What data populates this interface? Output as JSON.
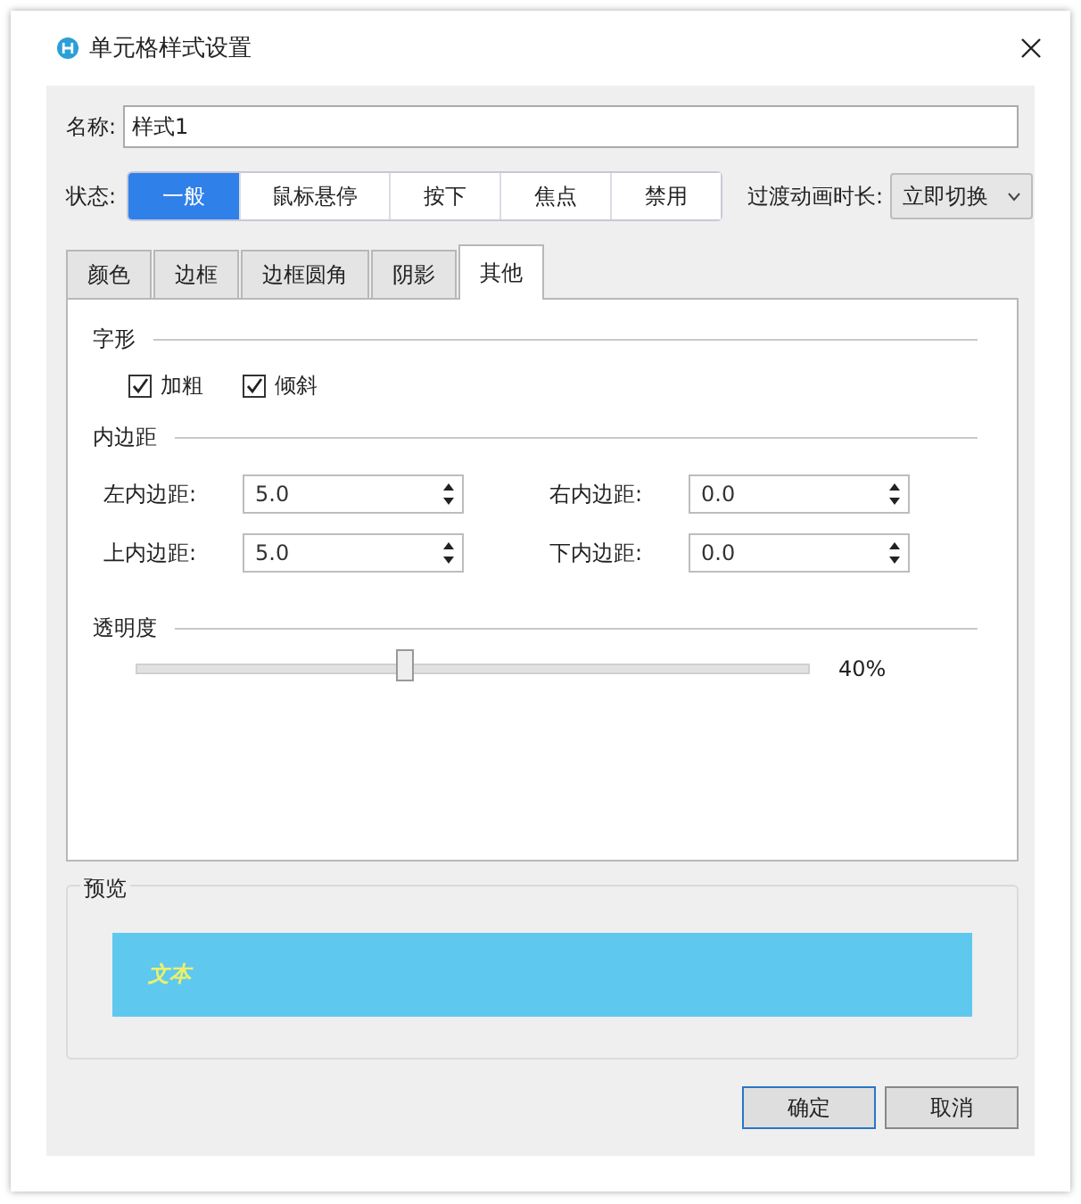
{
  "window": {
    "title": "单元格样式设置"
  },
  "name_field": {
    "label": "名称:",
    "value": "样式1"
  },
  "state": {
    "label": "状态:",
    "options": [
      {
        "label": "一般",
        "selected": true
      },
      {
        "label": "鼠标悬停",
        "selected": false
      },
      {
        "label": "按下",
        "selected": false
      },
      {
        "label": "焦点",
        "selected": false
      },
      {
        "label": "禁用",
        "selected": false
      }
    ]
  },
  "transition": {
    "label": "过渡动画时长:",
    "value": "立即切换"
  },
  "tabs": [
    {
      "label": "颜色",
      "selected": false
    },
    {
      "label": "边框",
      "selected": false
    },
    {
      "label": "边框圆角",
      "selected": false
    },
    {
      "label": "阴影",
      "selected": false
    },
    {
      "label": "其他",
      "selected": true
    }
  ],
  "font_style": {
    "title": "字形",
    "options": [
      {
        "label": "加粗",
        "checked": true
      },
      {
        "label": "倾斜",
        "checked": true
      }
    ]
  },
  "padding": {
    "title": "内边距",
    "fields": [
      {
        "label": "左内边距:",
        "value": "5.0"
      },
      {
        "label": "右内边距:",
        "value": "0.0"
      },
      {
        "label": "上内边距:",
        "value": "5.0"
      },
      {
        "label": "下内边距:",
        "value": "0.0"
      }
    ]
  },
  "opacity": {
    "title": "透明度",
    "level": 0.4,
    "reading": "40%"
  },
  "preview": {
    "title": "预览",
    "text": "文本"
  },
  "buttons": [
    {
      "label": "确定",
      "default": true
    },
    {
      "label": "取消",
      "default": false
    }
  ]
}
